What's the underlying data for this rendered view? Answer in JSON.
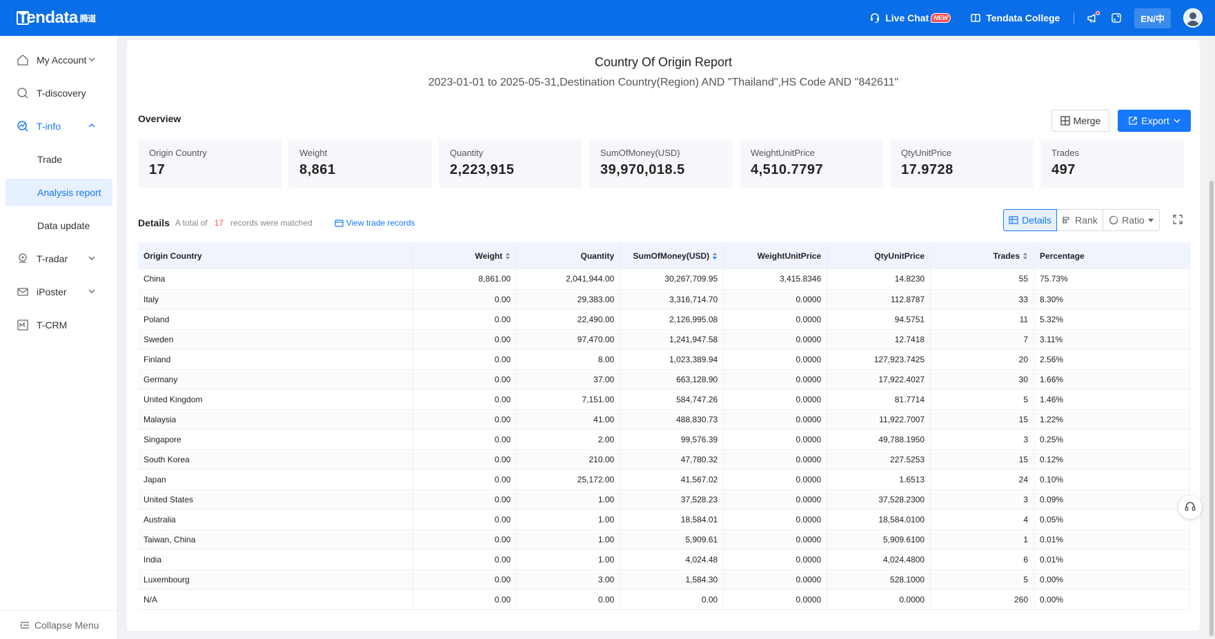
{
  "header": {
    "logo_text": "Tendata",
    "logo_cn": "腾道",
    "live_chat": "Live Chat",
    "new_badge": "NEW",
    "college": "Tendata College",
    "lang": "EN/中"
  },
  "sidebar": {
    "items": [
      {
        "label": "My Account"
      },
      {
        "label": "T-discovery"
      },
      {
        "label": "T-info"
      },
      {
        "label": "Trade"
      },
      {
        "label": "Analysis report"
      },
      {
        "label": "Data update"
      },
      {
        "label": "T-radar"
      },
      {
        "label": "iPoster"
      },
      {
        "label": "T-CRM"
      }
    ],
    "collapse": "Collapse Menu"
  },
  "report": {
    "title": "Country Of Origin Report",
    "subtitle": "2023-01-01 to 2025-05-31,Destination Country(Region) AND \"Thailand\",HS Code AND \"842611\""
  },
  "overview": {
    "label": "Overview",
    "merge": "Merge",
    "export": "Export",
    "stats": [
      {
        "label": "Origin Country",
        "value": "17"
      },
      {
        "label": "Weight",
        "value": "8,861"
      },
      {
        "label": "Quantity",
        "value": "2,223,915"
      },
      {
        "label": "SumOfMoney(USD)",
        "value": "39,970,018.5"
      },
      {
        "label": "WeightUnitPrice",
        "value": "4,510.7797"
      },
      {
        "label": "QtyUnitPrice",
        "value": "17.9728"
      },
      {
        "label": "Trades",
        "value": "497"
      }
    ]
  },
  "details": {
    "label": "Details",
    "total_prefix": "A total of",
    "count": "17",
    "total_suffix": "records were matched",
    "view_link": "View trade records",
    "tabs": [
      "Details",
      "Rank",
      "Ratio"
    ]
  },
  "table": {
    "headers": [
      "Origin Country",
      "Weight",
      "Quantity",
      "SumOfMoney(USD)",
      "WeightUnitPrice",
      "QtyUnitPrice",
      "Trades",
      "Percentage"
    ],
    "rows": [
      [
        "China",
        "8,861.00",
        "2,041,944.00",
        "30,267,709.95",
        "3,415.8346",
        "14.8230",
        "55",
        "75.73%"
      ],
      [
        "Italy",
        "0.00",
        "29,383.00",
        "3,316,714.70",
        "0.0000",
        "112.8787",
        "33",
        "8.30%"
      ],
      [
        "Poland",
        "0.00",
        "22,490.00",
        "2,126,995.08",
        "0.0000",
        "94.5751",
        "11",
        "5.32%"
      ],
      [
        "Sweden",
        "0.00",
        "97,470.00",
        "1,241,947.58",
        "0.0000",
        "12.7418",
        "7",
        "3.11%"
      ],
      [
        "Finland",
        "0.00",
        "8.00",
        "1,023,389.94",
        "0.0000",
        "127,923.7425",
        "20",
        "2.56%"
      ],
      [
        "Germany",
        "0.00",
        "37.00",
        "663,128.90",
        "0.0000",
        "17,922.4027",
        "30",
        "1.66%"
      ],
      [
        "United Kingdom",
        "0.00",
        "7,151.00",
        "584,747.26",
        "0.0000",
        "81.7714",
        "5",
        "1.46%"
      ],
      [
        "Malaysia",
        "0.00",
        "41.00",
        "488,830.73",
        "0.0000",
        "11,922.7007",
        "15",
        "1.22%"
      ],
      [
        "Singapore",
        "0.00",
        "2.00",
        "99,576.39",
        "0.0000",
        "49,788.1950",
        "3",
        "0.25%"
      ],
      [
        "South Korea",
        "0.00",
        "210.00",
        "47,780.32",
        "0.0000",
        "227.5253",
        "15",
        "0.12%"
      ],
      [
        "Japan",
        "0.00",
        "25,172.00",
        "41,567.02",
        "0.0000",
        "1.6513",
        "24",
        "0.10%"
      ],
      [
        "United States",
        "0.00",
        "1.00",
        "37,528.23",
        "0.0000",
        "37,528.2300",
        "3",
        "0.09%"
      ],
      [
        "Australia",
        "0.00",
        "1.00",
        "18,584.01",
        "0.0000",
        "18,584.0100",
        "4",
        "0.05%"
      ],
      [
        "Taiwan, China",
        "0.00",
        "1.00",
        "5,909.61",
        "0.0000",
        "5,909.6100",
        "1",
        "0.01%"
      ],
      [
        "India",
        "0.00",
        "1.00",
        "4,024.48",
        "0.0000",
        "4,024.4800",
        "6",
        "0.01%"
      ],
      [
        "Luxembourg",
        "0.00",
        "3.00",
        "1,584.30",
        "0.0000",
        "528.1000",
        "5",
        "0.00%"
      ],
      [
        "N/A",
        "0.00",
        "0.00",
        "0.00",
        "0.0000",
        "0.0000",
        "260",
        "0.00%"
      ]
    ]
  },
  "colors": {
    "brand": "#0a6ee8",
    "accent": "#1677ff",
    "highlight": "#ff4d4f"
  }
}
